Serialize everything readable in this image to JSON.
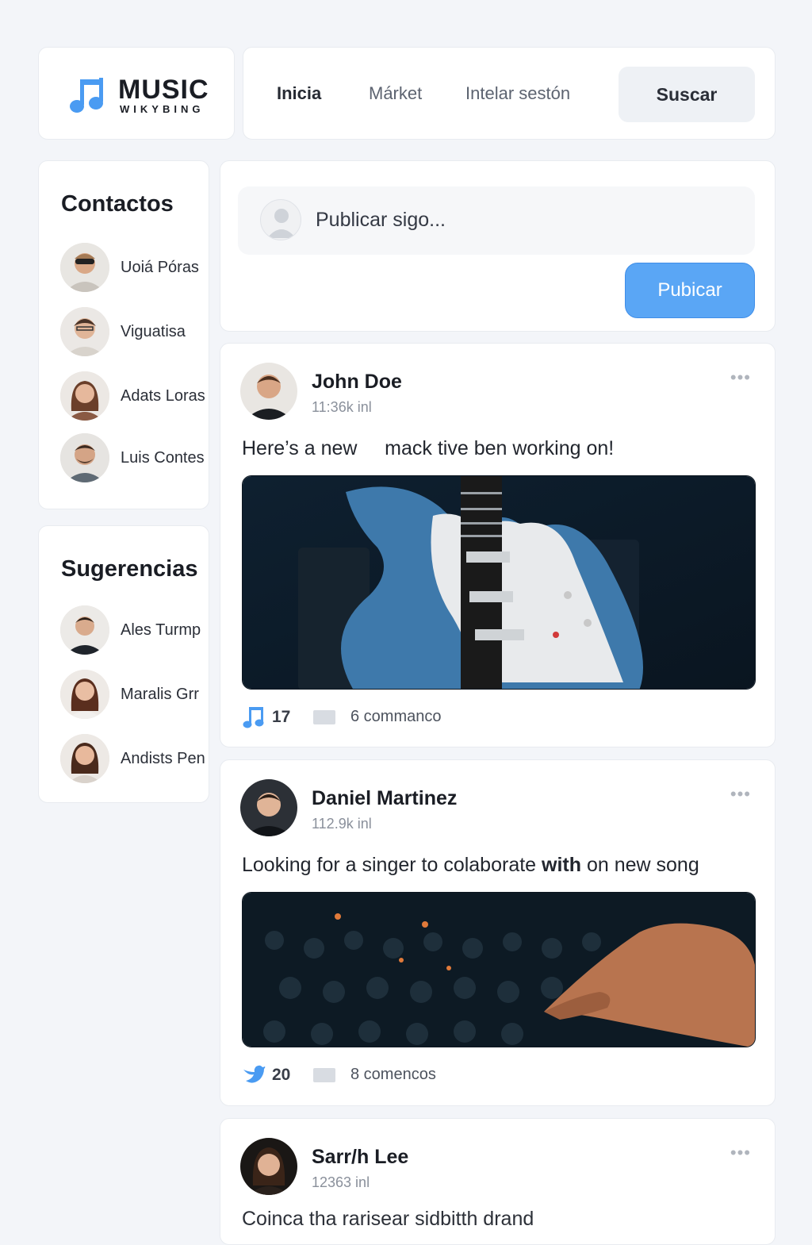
{
  "header": {
    "logo_title": "MUSIC",
    "logo_sub": "WIKYBING",
    "nav": [
      "Inicia",
      "Márket",
      "Intelar sestón"
    ],
    "search_label": "Suscar"
  },
  "sidebar": {
    "contacts_title": "Contactos",
    "contacts": [
      "Uoiá Póras",
      "Viguatisa",
      "Adats Loras",
      "Luis Contes"
    ],
    "suggestions_title": "Sugerencias",
    "suggestions": [
      "Ales Turmp",
      "Maralis Grr",
      "Andists Pen"
    ]
  },
  "composer": {
    "placeholder": "Publicar sigo...",
    "publish_label": "Pubicar"
  },
  "posts": [
    {
      "author": "John Doe",
      "meta": "11:36k inl",
      "text": "Here’s a new     mack tive ben working on!",
      "likes": "17",
      "comments": "6 commanco",
      "like_icon": "music-note-icon",
      "image": "blue-electric-guitar"
    },
    {
      "author": "Daniel Martinez",
      "meta": "112.9k inl",
      "text_before": "Looking for a singer to colaborate ",
      "text_bold": "with",
      "text_after": " on new song",
      "likes": "20",
      "comments": "8 comencos",
      "like_icon": "bird-icon",
      "image": "mixing-console-hand"
    },
    {
      "author": "Sarr/h Lee",
      "meta": "12363 inl",
      "text": "Coinca tha rarisear sidbitth drand"
    }
  ],
  "colors": {
    "accent": "#5aa6f5",
    "background": "#f3f5f9",
    "card": "#ffffff",
    "text_dark": "#1a1d24",
    "text_muted": "#8a909b"
  }
}
